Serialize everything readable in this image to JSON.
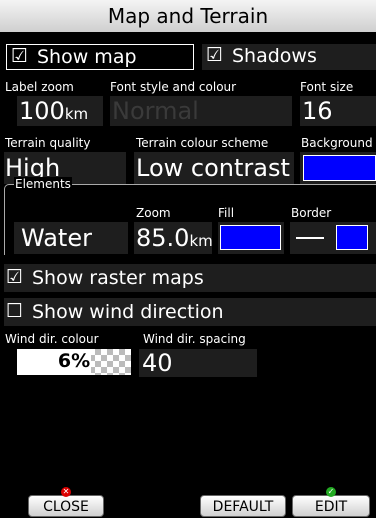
{
  "title": "Map and Terrain",
  "show_map": {
    "label": "Show map",
    "checked": true
  },
  "shadows": {
    "label": "Shadows",
    "checked": true
  },
  "label_zoom": {
    "label": "Label zoom",
    "value": "100",
    "unit": "km"
  },
  "font_style": {
    "label": "Font style and colour",
    "value": "Normal"
  },
  "font_size": {
    "label": "Font size",
    "value": "16"
  },
  "terrain_quality": {
    "label": "Terrain quality",
    "value": "High"
  },
  "terrain_colour_scheme": {
    "label": "Terrain colour scheme",
    "value": "Low contrast"
  },
  "background": {
    "label": "Background",
    "color": "#0000ff"
  },
  "elements": {
    "group_label": "Elements",
    "zoom_label": "Zoom",
    "fill_label": "Fill",
    "border_label": "Border",
    "item": "Water",
    "zoom_value": "85.0",
    "zoom_unit": "km",
    "fill_color": "#0000ff",
    "border_color": "#0000ff"
  },
  "show_raster_maps": {
    "label": "Show raster maps",
    "checked": true
  },
  "show_wind_direction": {
    "label": "Show wind direction",
    "checked": false
  },
  "wind_dir_colour": {
    "label": "Wind dir. colour",
    "value": "6%",
    "fill_fraction": 0.65
  },
  "wind_dir_spacing": {
    "label": "Wind dir. spacing",
    "value": "40"
  },
  "buttons": {
    "close": "CLOSE",
    "default": "DEFAULT",
    "edit": "EDIT"
  },
  "checkbox_glyphs": {
    "checked": "☑",
    "unchecked": "☐"
  }
}
